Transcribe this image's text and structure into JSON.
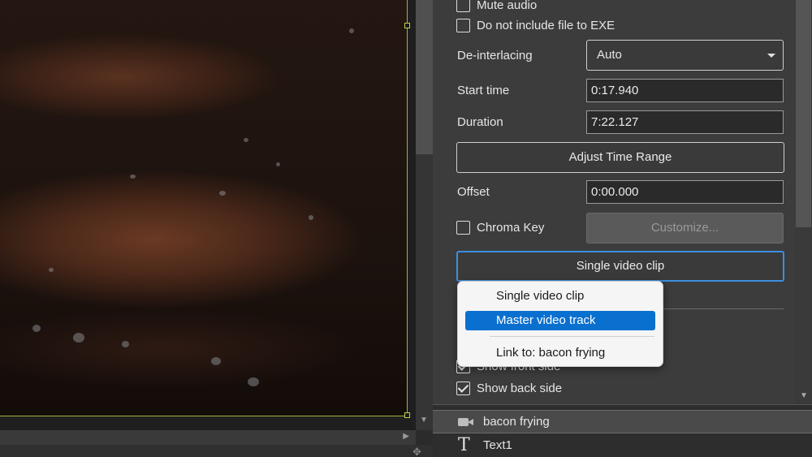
{
  "properties": {
    "mute_audio_label": "Mute audio",
    "no_exe_label": "Do not include file to EXE",
    "deinterlacing_label": "De-interlacing",
    "deinterlacing_value": "Auto",
    "start_time_label": "Start time",
    "start_time_value": "0:17.940",
    "duration_label": "Duration",
    "duration_value": "7:22.127",
    "adjust_button": "Adjust Time Range",
    "offset_label": "Offset",
    "offset_value": "0:00.000",
    "chroma_key_label": "Chroma Key",
    "customize_button": "Customize...",
    "video_mode_selected": "Single video clip",
    "show_front_label": "Show front side",
    "show_back_label": "Show back side"
  },
  "menu": {
    "items": [
      "Single video clip",
      "Master video track",
      "Link to: bacon frying"
    ],
    "highlighted": "Master video track"
  },
  "objects": [
    {
      "name": "bacon frying",
      "icon": "video-camera-icon",
      "selected": true
    },
    {
      "name": "Text1",
      "icon": "text-icon",
      "selected": false
    }
  ],
  "colors": {
    "selection_outline": "#b9d24a",
    "focus_blue": "#3d8ee0",
    "menu_highlight": "#0a70d0"
  }
}
